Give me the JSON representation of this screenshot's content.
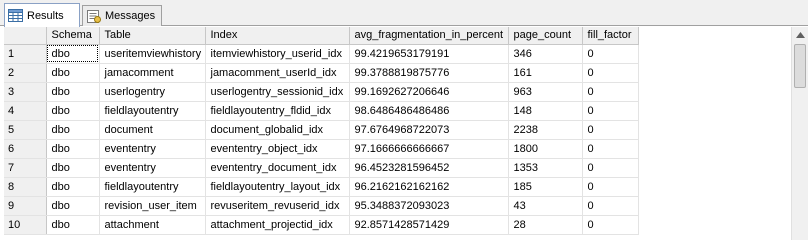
{
  "tabs": [
    {
      "label": "Results",
      "icon": "results-grid-icon",
      "active": true
    },
    {
      "label": "Messages",
      "icon": "messages-icon",
      "active": false
    }
  ],
  "grid": {
    "columns": [
      "Schema",
      "Table",
      "Index",
      "avg_fragmentation_in_percent",
      "page_count",
      "fill_factor"
    ],
    "rows": [
      {
        "num": "1",
        "cells": [
          "dbo",
          "useritemviewhistory",
          "itemviewhistory_userid_idx",
          "99.4219653179191",
          "346",
          "0"
        ]
      },
      {
        "num": "2",
        "cells": [
          "dbo",
          "jamacomment",
          "jamacomment_userId_idx",
          "99.3788819875776",
          "161",
          "0"
        ]
      },
      {
        "num": "3",
        "cells": [
          "dbo",
          "userlogentry",
          "userlogentry_sessionid_idx",
          "99.1692627206646",
          "963",
          "0"
        ]
      },
      {
        "num": "4",
        "cells": [
          "dbo",
          "fieldlayoutentry",
          "fieldlayoutentry_fldid_idx",
          "98.6486486486486",
          "148",
          "0"
        ]
      },
      {
        "num": "5",
        "cells": [
          "dbo",
          "document",
          "document_globalid_idx",
          "97.6764968722073",
          "2238",
          "0"
        ]
      },
      {
        "num": "6",
        "cells": [
          "dbo",
          "evententry",
          "evententry_object_idx",
          "97.1666666666667",
          "1800",
          "0"
        ]
      },
      {
        "num": "7",
        "cells": [
          "dbo",
          "evententry",
          "evententry_document_idx",
          "96.4523281596452",
          "1353",
          "0"
        ]
      },
      {
        "num": "8",
        "cells": [
          "dbo",
          "fieldlayoutentry",
          "fieldlayoutentry_layout_idx",
          "96.2162162162162",
          "185",
          "0"
        ]
      },
      {
        "num": "9",
        "cells": [
          "dbo",
          "revision_user_item",
          "revuseritem_revuserid_idx",
          "95.3488372093023",
          "43",
          "0"
        ]
      },
      {
        "num": "10",
        "cells": [
          "dbo",
          "attachment",
          "attachment_projectid_idx",
          "92.8571428571429",
          "28",
          "0"
        ]
      }
    ]
  }
}
